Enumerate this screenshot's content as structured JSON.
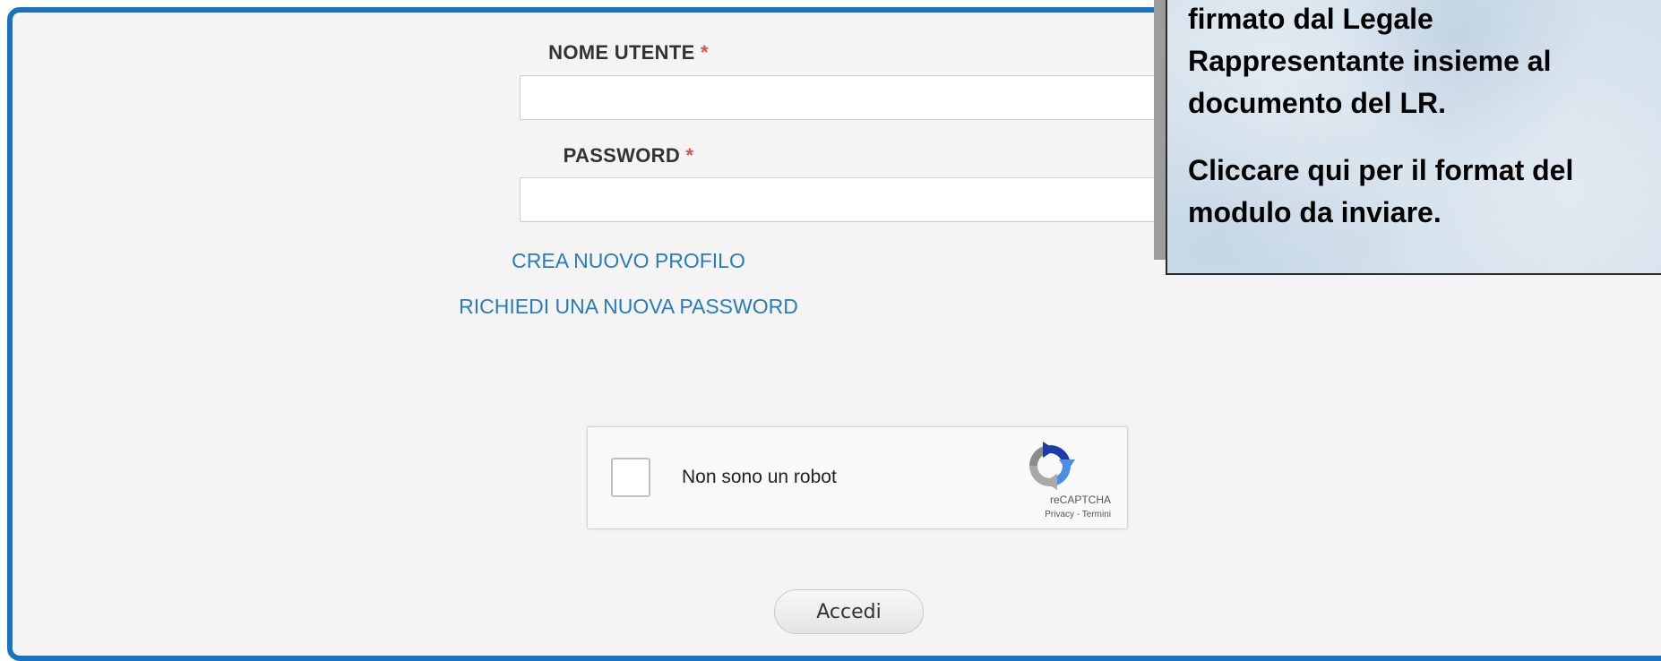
{
  "login": {
    "username_label": "NOME UTENTE",
    "password_label": "PASSWORD",
    "required_mark": "*",
    "username_value": "",
    "password_value": "",
    "create_profile_link": "CREA NUOVO PROFILO",
    "reset_password_link": "RICHIEDI UNA NUOVA PASSWORD",
    "submit_label": "Accedi"
  },
  "recaptcha": {
    "checkbox_label": "Non sono un robot",
    "brand": "reCAPTCHA",
    "privacy_link": "Privacy",
    "separator": " - ",
    "terms_link": "Termini",
    "logo_icon": "recaptcha-logo-icon"
  },
  "info_box": {
    "lines": [
      "firmato dal Legale",
      "Rappresentante insieme al",
      "documento del LR.",
      "Cliccare qui per il format del",
      "modulo da inviare."
    ]
  },
  "colors": {
    "panel_border": "#1a73c2",
    "link": "#2a7cb8",
    "required": "#d9534f",
    "panel_bg": "#f4f4f4"
  }
}
